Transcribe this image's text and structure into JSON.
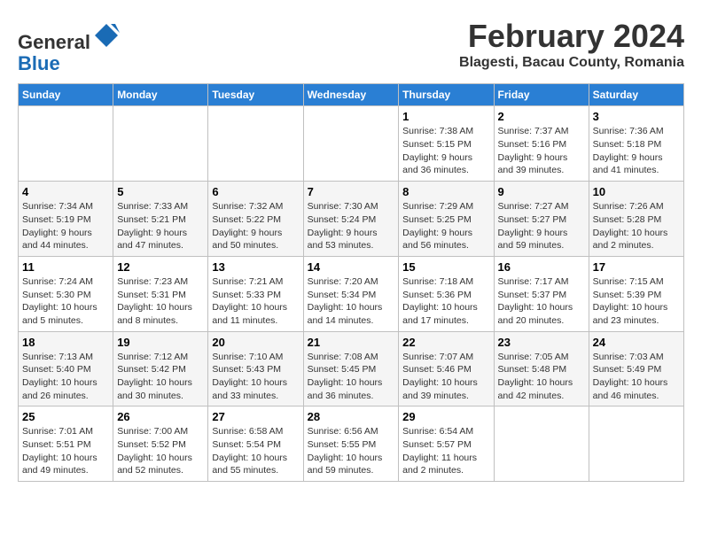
{
  "header": {
    "logo_general": "General",
    "logo_blue": "Blue",
    "main_title": "February 2024",
    "sub_title": "Blagesti, Bacau County, Romania"
  },
  "calendar": {
    "days_of_week": [
      "Sunday",
      "Monday",
      "Tuesday",
      "Wednesday",
      "Thursday",
      "Friday",
      "Saturday"
    ],
    "weeks": [
      [
        {
          "day": "",
          "info": ""
        },
        {
          "day": "",
          "info": ""
        },
        {
          "day": "",
          "info": ""
        },
        {
          "day": "",
          "info": ""
        },
        {
          "day": "1",
          "info": "Sunrise: 7:38 AM\nSunset: 5:15 PM\nDaylight: 9 hours and 36 minutes."
        },
        {
          "day": "2",
          "info": "Sunrise: 7:37 AM\nSunset: 5:16 PM\nDaylight: 9 hours and 39 minutes."
        },
        {
          "day": "3",
          "info": "Sunrise: 7:36 AM\nSunset: 5:18 PM\nDaylight: 9 hours and 41 minutes."
        }
      ],
      [
        {
          "day": "4",
          "info": "Sunrise: 7:34 AM\nSunset: 5:19 PM\nDaylight: 9 hours and 44 minutes."
        },
        {
          "day": "5",
          "info": "Sunrise: 7:33 AM\nSunset: 5:21 PM\nDaylight: 9 hours and 47 minutes."
        },
        {
          "day": "6",
          "info": "Sunrise: 7:32 AM\nSunset: 5:22 PM\nDaylight: 9 hours and 50 minutes."
        },
        {
          "day": "7",
          "info": "Sunrise: 7:30 AM\nSunset: 5:24 PM\nDaylight: 9 hours and 53 minutes."
        },
        {
          "day": "8",
          "info": "Sunrise: 7:29 AM\nSunset: 5:25 PM\nDaylight: 9 hours and 56 minutes."
        },
        {
          "day": "9",
          "info": "Sunrise: 7:27 AM\nSunset: 5:27 PM\nDaylight: 9 hours and 59 minutes."
        },
        {
          "day": "10",
          "info": "Sunrise: 7:26 AM\nSunset: 5:28 PM\nDaylight: 10 hours and 2 minutes."
        }
      ],
      [
        {
          "day": "11",
          "info": "Sunrise: 7:24 AM\nSunset: 5:30 PM\nDaylight: 10 hours and 5 minutes."
        },
        {
          "day": "12",
          "info": "Sunrise: 7:23 AM\nSunset: 5:31 PM\nDaylight: 10 hours and 8 minutes."
        },
        {
          "day": "13",
          "info": "Sunrise: 7:21 AM\nSunset: 5:33 PM\nDaylight: 10 hours and 11 minutes."
        },
        {
          "day": "14",
          "info": "Sunrise: 7:20 AM\nSunset: 5:34 PM\nDaylight: 10 hours and 14 minutes."
        },
        {
          "day": "15",
          "info": "Sunrise: 7:18 AM\nSunset: 5:36 PM\nDaylight: 10 hours and 17 minutes."
        },
        {
          "day": "16",
          "info": "Sunrise: 7:17 AM\nSunset: 5:37 PM\nDaylight: 10 hours and 20 minutes."
        },
        {
          "day": "17",
          "info": "Sunrise: 7:15 AM\nSunset: 5:39 PM\nDaylight: 10 hours and 23 minutes."
        }
      ],
      [
        {
          "day": "18",
          "info": "Sunrise: 7:13 AM\nSunset: 5:40 PM\nDaylight: 10 hours and 26 minutes."
        },
        {
          "day": "19",
          "info": "Sunrise: 7:12 AM\nSunset: 5:42 PM\nDaylight: 10 hours and 30 minutes."
        },
        {
          "day": "20",
          "info": "Sunrise: 7:10 AM\nSunset: 5:43 PM\nDaylight: 10 hours and 33 minutes."
        },
        {
          "day": "21",
          "info": "Sunrise: 7:08 AM\nSunset: 5:45 PM\nDaylight: 10 hours and 36 minutes."
        },
        {
          "day": "22",
          "info": "Sunrise: 7:07 AM\nSunset: 5:46 PM\nDaylight: 10 hours and 39 minutes."
        },
        {
          "day": "23",
          "info": "Sunrise: 7:05 AM\nSunset: 5:48 PM\nDaylight: 10 hours and 42 minutes."
        },
        {
          "day": "24",
          "info": "Sunrise: 7:03 AM\nSunset: 5:49 PM\nDaylight: 10 hours and 46 minutes."
        }
      ],
      [
        {
          "day": "25",
          "info": "Sunrise: 7:01 AM\nSunset: 5:51 PM\nDaylight: 10 hours and 49 minutes."
        },
        {
          "day": "26",
          "info": "Sunrise: 7:00 AM\nSunset: 5:52 PM\nDaylight: 10 hours and 52 minutes."
        },
        {
          "day": "27",
          "info": "Sunrise: 6:58 AM\nSunset: 5:54 PM\nDaylight: 10 hours and 55 minutes."
        },
        {
          "day": "28",
          "info": "Sunrise: 6:56 AM\nSunset: 5:55 PM\nDaylight: 10 hours and 59 minutes."
        },
        {
          "day": "29",
          "info": "Sunrise: 6:54 AM\nSunset: 5:57 PM\nDaylight: 11 hours and 2 minutes."
        },
        {
          "day": "",
          "info": ""
        },
        {
          "day": "",
          "info": ""
        }
      ]
    ]
  }
}
